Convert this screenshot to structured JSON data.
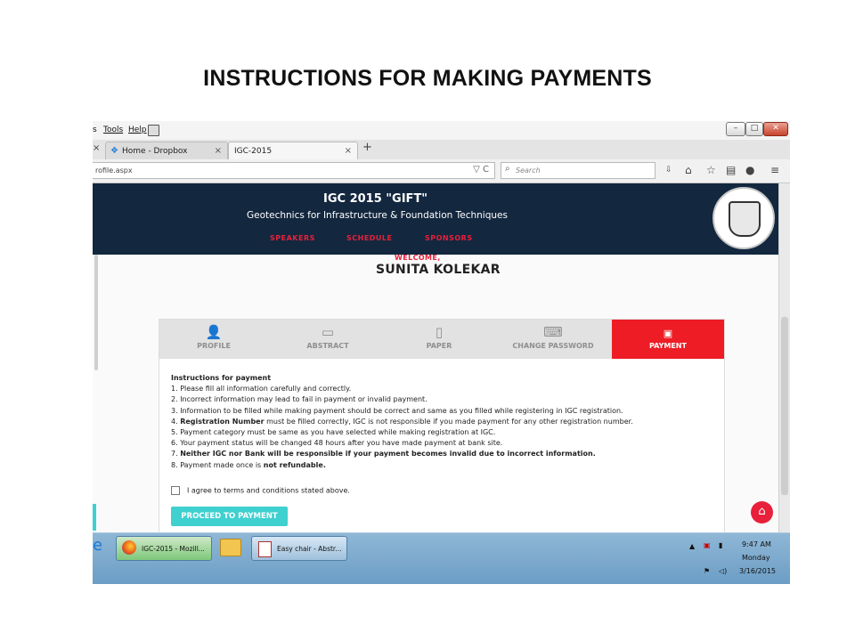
{
  "slide": {
    "title": "INSTRUCTIONS FOR MAKING PAYMENTS"
  },
  "browser": {
    "menu": [
      "s",
      "Tools",
      "Help"
    ],
    "window_buttons": {
      "minimize": "–",
      "maximize": "□",
      "close": "✕"
    },
    "tabs": [
      {
        "label": "Home - Dropbox",
        "close": "×"
      },
      {
        "label": "IGC-2015",
        "close": "×"
      }
    ],
    "new_tab": "+",
    "left_close": "×",
    "url": "rofile.aspx",
    "url_controls": "▽ C",
    "search_placeholder": "Search",
    "toolbar_icons": [
      "download-icon",
      "home-icon",
      "star-icon",
      "clipboard-icon",
      "chat-icon",
      "menu-icon"
    ]
  },
  "site": {
    "title": "IGC 2015 \"GIFT\"",
    "subtitle": "Geotechnics for Infrastructure & Foundation Techniques",
    "nav": [
      "SPEAKERS",
      "SCHEDULE",
      "SPONSORS"
    ],
    "welcome": "WELCOME,",
    "username": "SUNITA KOLEKAR",
    "steps": [
      {
        "label": "PROFILE",
        "icon": "user-icon"
      },
      {
        "label": "ABSTRACT",
        "icon": "document-icon"
      },
      {
        "label": "PAPER",
        "icon": "pdf-icon"
      },
      {
        "label": "CHANGE PASSWORD",
        "icon": "keyboard-icon"
      },
      {
        "label": "PAYMENT",
        "icon": "money-icon"
      }
    ],
    "instructions_heading": "Instructions for payment",
    "instructions": [
      {
        "prefix": "1. ",
        "bold": "",
        "rest": "Please fill all information carefully and correctly."
      },
      {
        "prefix": "2. ",
        "bold": "",
        "rest": "Incorrect information may lead to fail in payment or invalid payment."
      },
      {
        "prefix": "3. ",
        "bold": "",
        "rest": "Information to be filled while making payment should be correct and same as you filled while registering in IGC registration."
      },
      {
        "prefix": "4. ",
        "bold": "Registration Number",
        "rest": " must be filled correctly, IGC is not responsible if you made payment for any other registration number."
      },
      {
        "prefix": "5. ",
        "bold": "",
        "rest": "Payment category must be same as you have selected while making registration at IGC."
      },
      {
        "prefix": "6. ",
        "bold": "",
        "rest": "Your payment status will be changed 48 hours after you have made payment at bank site."
      },
      {
        "prefix": "7. ",
        "bold": "Neither IGC nor Bank will be responsible if your payment becomes invalid due to incorrect information.",
        "rest": ""
      },
      {
        "prefix": "8. ",
        "bold": "",
        "rest": "Payment made once is ",
        "tail_bold": "not refundable."
      }
    ],
    "agree_text": "I agree to terms and conditions stated above.",
    "proceed_label": "PROCEED TO PAYMENT"
  },
  "taskbar": {
    "items": [
      {
        "label": "IGC-2015 - Mozill...",
        "icon": "firefox-icon"
      },
      {
        "label": "",
        "icon": "folder-icon"
      },
      {
        "label": "Easy chair - Abstr...",
        "icon": "document-icon"
      }
    ],
    "time": "9:47 AM",
    "day": "Monday",
    "date": "3/16/2015"
  }
}
